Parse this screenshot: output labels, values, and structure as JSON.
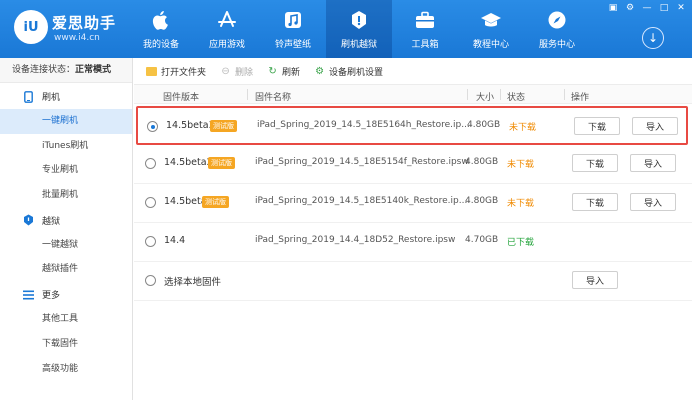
{
  "header": {
    "app_name": "爱思助手",
    "app_url": "www.i4.cn",
    "logo_text": "iU",
    "nav": [
      {
        "label": "我的设备",
        "icon": "apple-icon"
      },
      {
        "label": "应用游戏",
        "icon": "app-store-icon"
      },
      {
        "label": "铃声壁纸",
        "icon": "music-note-icon"
      },
      {
        "label": "刷机越狱",
        "icon": "dropbox-icon"
      },
      {
        "label": "工具箱",
        "icon": "toolbox-icon"
      },
      {
        "label": "教程中心",
        "icon": "graduation-cap-icon"
      },
      {
        "label": "服务中心",
        "icon": "compass-icon"
      }
    ],
    "active_nav": "刷机越狱"
  },
  "sidebar": {
    "status_label": "设备连接状态：",
    "status_value": "正常模式",
    "groups": [
      {
        "label": "刷机",
        "icon": "phone-icon",
        "items": [
          "一键刷机",
          "iTunes刷机",
          "专业刷机",
          "批量刷机"
        ]
      },
      {
        "label": "越狱",
        "icon": "jailbreak-icon",
        "items": [
          "一键越狱",
          "越狱插件"
        ]
      },
      {
        "label": "更多",
        "icon": "menu-icon",
        "items": [
          "其他工具",
          "下载固件",
          "高级功能"
        ]
      }
    ],
    "active_item": "一键刷机"
  },
  "toolbar": {
    "open_folder": "打开文件夹",
    "delete": "删除",
    "refresh": "刷新",
    "settings": "设备刷机设置"
  },
  "table": {
    "columns": {
      "version": "固件版本",
      "name": "固件名称",
      "size": "大小",
      "status": "状态",
      "action": "操作"
    },
    "rows": [
      {
        "version": "14.5beta3",
        "tag": "测试版",
        "name": "iPad_Spring_2019_14.5_18E5164h_Restore.ip...",
        "size": "4.80GB",
        "status": "未下载",
        "status_color": "#f08a00",
        "download": "下载",
        "import": "导入",
        "selected": true
      },
      {
        "version": "14.5beta2",
        "tag": "测试版",
        "name": "iPad_Spring_2019_14.5_18E5154f_Restore.ipsw",
        "size": "4.80GB",
        "status": "未下载",
        "status_color": "#f08a00",
        "download": "下载",
        "import": "导入",
        "selected": false
      },
      {
        "version": "14.5beta",
        "tag": "测试版",
        "name": "iPad_Spring_2019_14.5_18E5140k_Restore.ip...",
        "size": "4.80GB",
        "status": "未下载",
        "status_color": "#f08a00",
        "download": "下载",
        "import": "导入",
        "selected": false
      },
      {
        "version": "14.4",
        "tag": "",
        "name": "iPad_Spring_2019_14.4_18D52_Restore.ipsw",
        "size": "4.70GB",
        "status": "已下载",
        "status_color": "#22a33a",
        "download": "下载",
        "import": "导入",
        "selected": false
      }
    ],
    "local_row": {
      "label": "选择本地固件",
      "import": "导入"
    }
  }
}
